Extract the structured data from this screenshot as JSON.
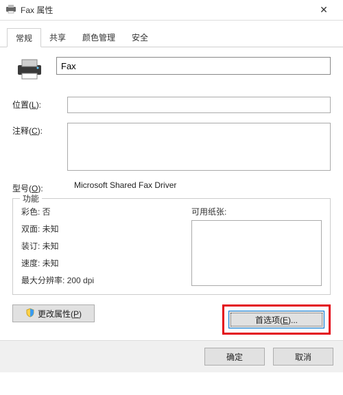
{
  "title": "Fax 属性",
  "closeGlyph": "✕",
  "tabs": [
    "常规",
    "共享",
    "颜色管理",
    "安全"
  ],
  "activeTab": 0,
  "fields": {
    "name_value": "Fax",
    "location_label_pre": "位置(",
    "location_hotkey": "L",
    "location_label_post": "):",
    "comment_label_pre": "注释(",
    "comment_hotkey": "C",
    "comment_label_post": "):",
    "model_label_pre": "型号(",
    "model_hotkey": "O",
    "model_label_post": "):",
    "model_value": "Microsoft Shared Fax Driver"
  },
  "func": {
    "legend": "功能",
    "color": "彩色: 否",
    "duplex": "双面: 未知",
    "staple": "装订: 未知",
    "speed": "速度: 未知",
    "maxres": "最大分辨率: 200 dpi",
    "paper_label": "可用纸张:"
  },
  "buttons": {
    "change_pre": "更改属性(",
    "change_hotkey": "P",
    "change_post": ")",
    "pref_pre": "首选项(",
    "pref_hotkey": "E",
    "pref_post": ")...",
    "ok": "确定",
    "cancel": "取消"
  }
}
